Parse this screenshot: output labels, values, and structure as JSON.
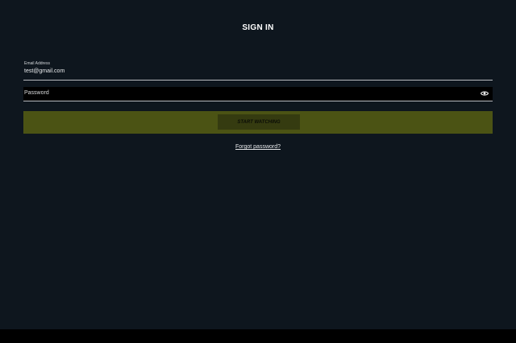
{
  "header": {
    "title": "SIGN IN"
  },
  "form": {
    "email": {
      "label": "Email Address",
      "value": "test@gmail.com"
    },
    "password": {
      "placeholder": "Password",
      "toggle_icon": "eye-icon"
    },
    "submit_label": "START WATCHING",
    "forgot_label": "Forgot password?"
  },
  "colors": {
    "background": "#0e161e",
    "cta_bar": "#4b5314",
    "cta_button": "#353b10",
    "password_bg": "#000000"
  }
}
